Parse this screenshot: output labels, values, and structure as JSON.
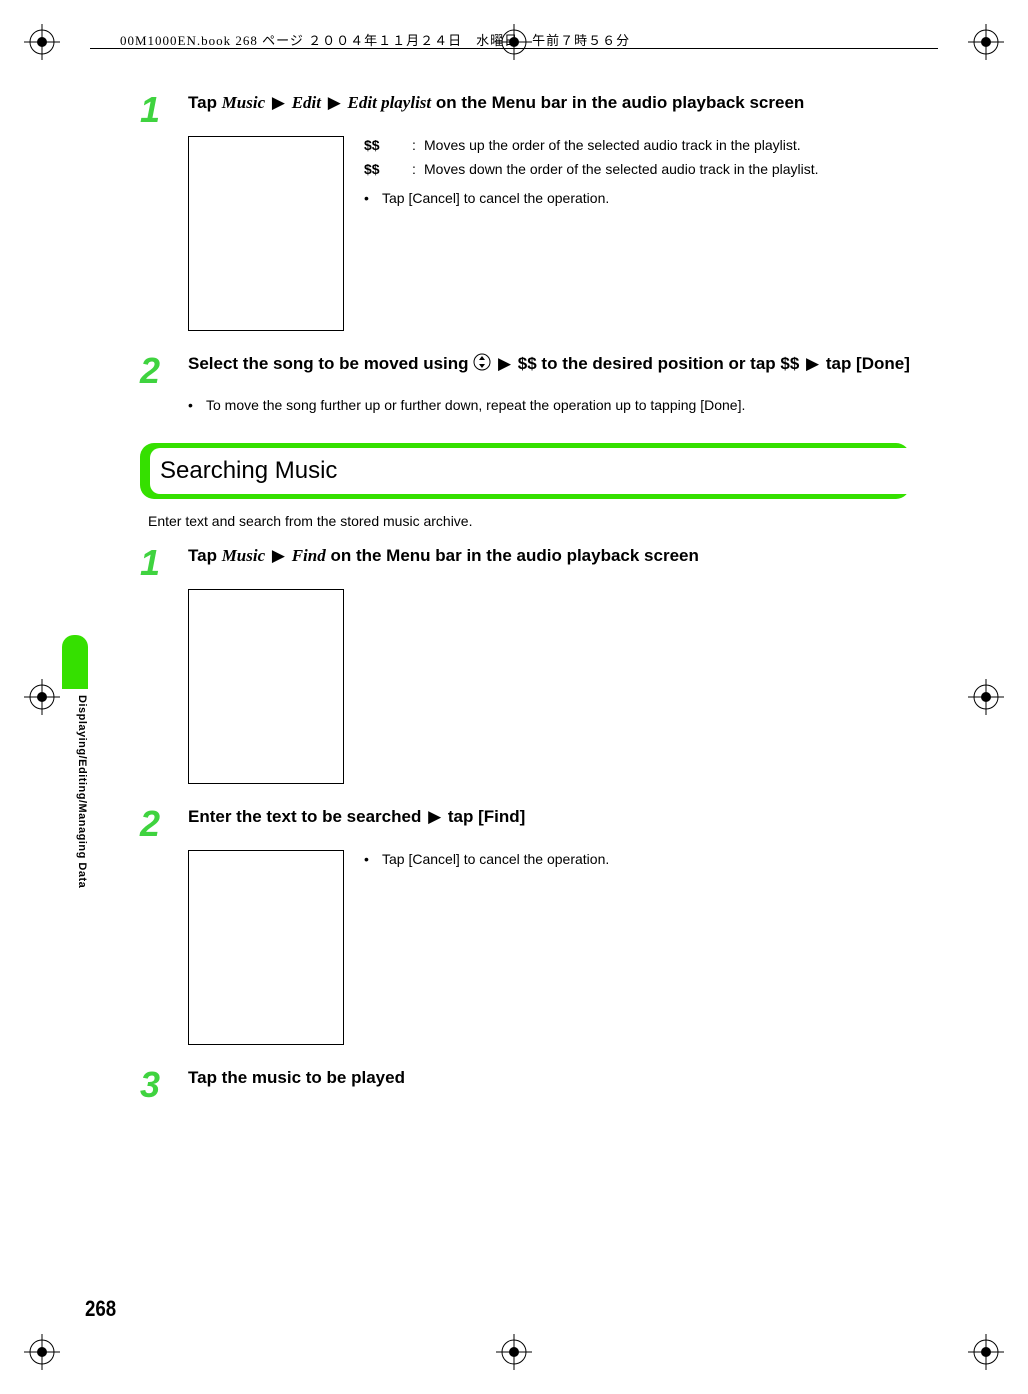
{
  "header": {
    "runner": "00M1000EN.book  268 ページ  ２００４年１１月２４日　水曜日　午前７時５６分"
  },
  "sideTab": {
    "label": "Displaying/Editing/Managing Data"
  },
  "pageNumber": "268",
  "block1": {
    "step1": {
      "num": "1",
      "titleParts": {
        "p0": "Tap ",
        "m1": "Music",
        "m2": "Edit",
        "m3": "Edit playlist",
        "p1": " on the Menu bar in the audio playback screen"
      },
      "table": {
        "r1": {
          "sym": "$$",
          "colon": ":",
          "txt": "Moves up the order of the selected audio track in the playlist."
        },
        "r2": {
          "sym": "$$",
          "colon": ":",
          "txt": "Moves down the order of the selected audio track in the playlist."
        }
      },
      "note": "Tap [Cancel] to cancel the operation."
    },
    "step2": {
      "num": "2",
      "titleParts": {
        "p0": "Select the song to be moved using ",
        "p1": " $$ to the desired position or tap $$ ",
        "p2": " tap [Done]"
      },
      "bullet": "To move the song further up or further down, repeat the operation up to tapping [Done]."
    }
  },
  "section": {
    "heading": "Searching Music",
    "intro": "Enter text and search from the stored music archive.",
    "step1": {
      "num": "1",
      "titleParts": {
        "p0": "Tap ",
        "m1": "Music",
        "m2": "Find",
        "p1": " on the Menu bar in the audio playback screen"
      }
    },
    "step2": {
      "num": "2",
      "titleParts": {
        "p0": "Enter the text to be searched ",
        "p1": " tap [Find]"
      },
      "note": "Tap [Cancel] to cancel the operation."
    },
    "step3": {
      "num": "3",
      "title": "Tap the music to be played"
    }
  },
  "glyphs": {
    "arrow": "▶",
    "bullet": "•"
  }
}
